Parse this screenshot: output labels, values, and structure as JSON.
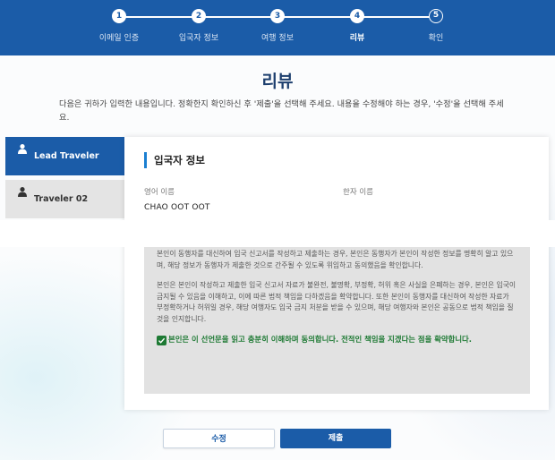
{
  "stepper": {
    "steps": [
      {
        "number": "1",
        "label": "이메일 인증",
        "state": "done"
      },
      {
        "number": "2",
        "label": "입국자 정보",
        "state": "done"
      },
      {
        "number": "3",
        "label": "여행 정보",
        "state": "done"
      },
      {
        "number": "4",
        "label": "리뷰",
        "state": "current"
      },
      {
        "number": "5",
        "label": "확인",
        "state": "pending"
      }
    ]
  },
  "page": {
    "title": "리뷰",
    "intro": "다음은 귀하가 입력한 내용입니다. 정확한지 확인하신 후 '제출'을 선택해 주세요. 내용을 수정해야 하는 경우, '수정'을 선택해 주세요."
  },
  "travelers": {
    "tabs": [
      {
        "label": "Lead Traveler",
        "active": true
      },
      {
        "label": "Traveler 02",
        "active": false
      }
    ]
  },
  "section": {
    "title": "입국자 정보",
    "fields": [
      {
        "label": "영어 이름",
        "value": "CHAO OOT OOT"
      },
      {
        "label": "한자 이름",
        "value": ""
      }
    ]
  },
  "declaration": {
    "paragraphs": [
      "본인이 동행자를 대신하여 입국 신고서를 작성하고 제출하는 경우, 본인은 동행자가 본인이 작성한 정보를 명확히 알고 있으며, 해당 정보가 동행자가 제출한 것으로 간주될 수 있도록 위임하고 동의했음을 확인합니다.",
      "본인은 본인이 작성하고 제출한 입국 신고서 자료가 불완전, 불명확, 부정확, 허위 혹은 사실을 은폐하는 경우, 본인은 입국이 금지될 수 있음을 이해하고, 이에 따른 법적 책임을 다하겠음을 확약합니다. 또한 본인이 동행자를 대신하여 작성한 자료가 부정확하거나 허위일 경우, 해당 여행자도 입국 금지 처분을 받을 수 있으며, 해당 여행자와 본인은 공동으로 법적 책임을 질 것을 인지합니다."
    ],
    "agreement": "본인은 이 선언문을 읽고 충분히 이해하며 동의합니다. 전적인 책임을 지겠다는 점을 확약합니다.",
    "agreed": true
  },
  "buttons": {
    "edit": "수정",
    "submit": "제출"
  },
  "colors": {
    "primary": "#1b5ca8",
    "accent_bar": "#1b7fd1",
    "agree_green": "#1e7a34",
    "declaration_bg": "#e2e2e2"
  },
  "icons": {
    "traveler_tab": "user-icon",
    "agree": "checkbox-checked-icon"
  }
}
